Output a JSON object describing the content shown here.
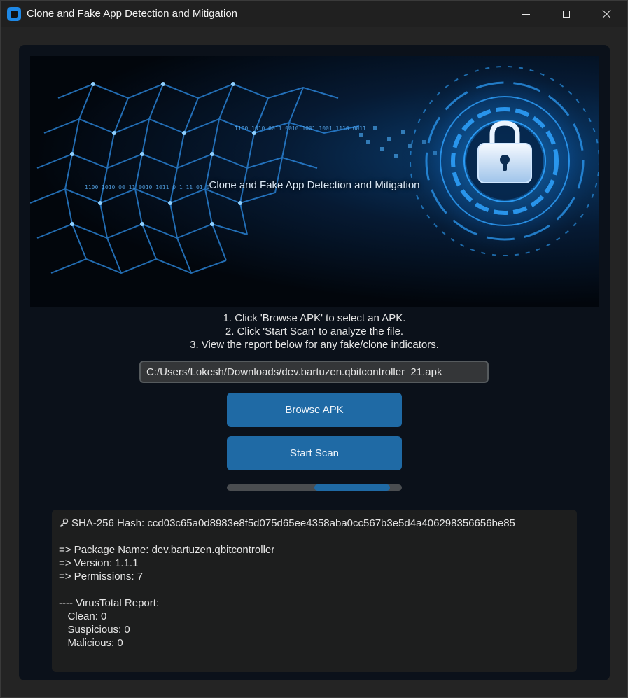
{
  "window": {
    "title": "Clone and Fake App Detection and Mitigation"
  },
  "banner": {
    "caption": "Clone and Fake App Detection and Mitigation"
  },
  "instructions": [
    "1. Click 'Browse APK' to select an APK.",
    "2. Click 'Start Scan' to analyze the file.",
    "3. View the report below for any fake/clone indicators."
  ],
  "file_path": {
    "value": "C:/Users/Lokesh/Downloads/dev.bartuzen.qbitcontroller_21.apk"
  },
  "buttons": {
    "browse": "Browse APK",
    "scan": "Start Scan"
  },
  "progress": {
    "start_fraction": 0.5,
    "end_fraction": 0.93
  },
  "report": {
    "lines": [
      "SHA-256 Hash: ccd03c65a0d8983e8f5d075d65ee4358aba0cc567b3e5d4a406298356656be85",
      "",
      "=> Package Name: dev.bartuzen.qbitcontroller",
      "=> Version: 1.1.1",
      "=> Permissions: 7",
      "",
      "---- VirusTotal Report:",
      "   Clean: 0",
      "   Suspicious: 0",
      "   Malicious: 0"
    ]
  },
  "colors": {
    "accent": "#1f6aa5",
    "frame_bg": "#0b111a",
    "report_bg": "#1d1e1e"
  },
  "icons": {
    "app": "app-icon",
    "hash": "key-icon",
    "banner": "padlock-icon"
  }
}
